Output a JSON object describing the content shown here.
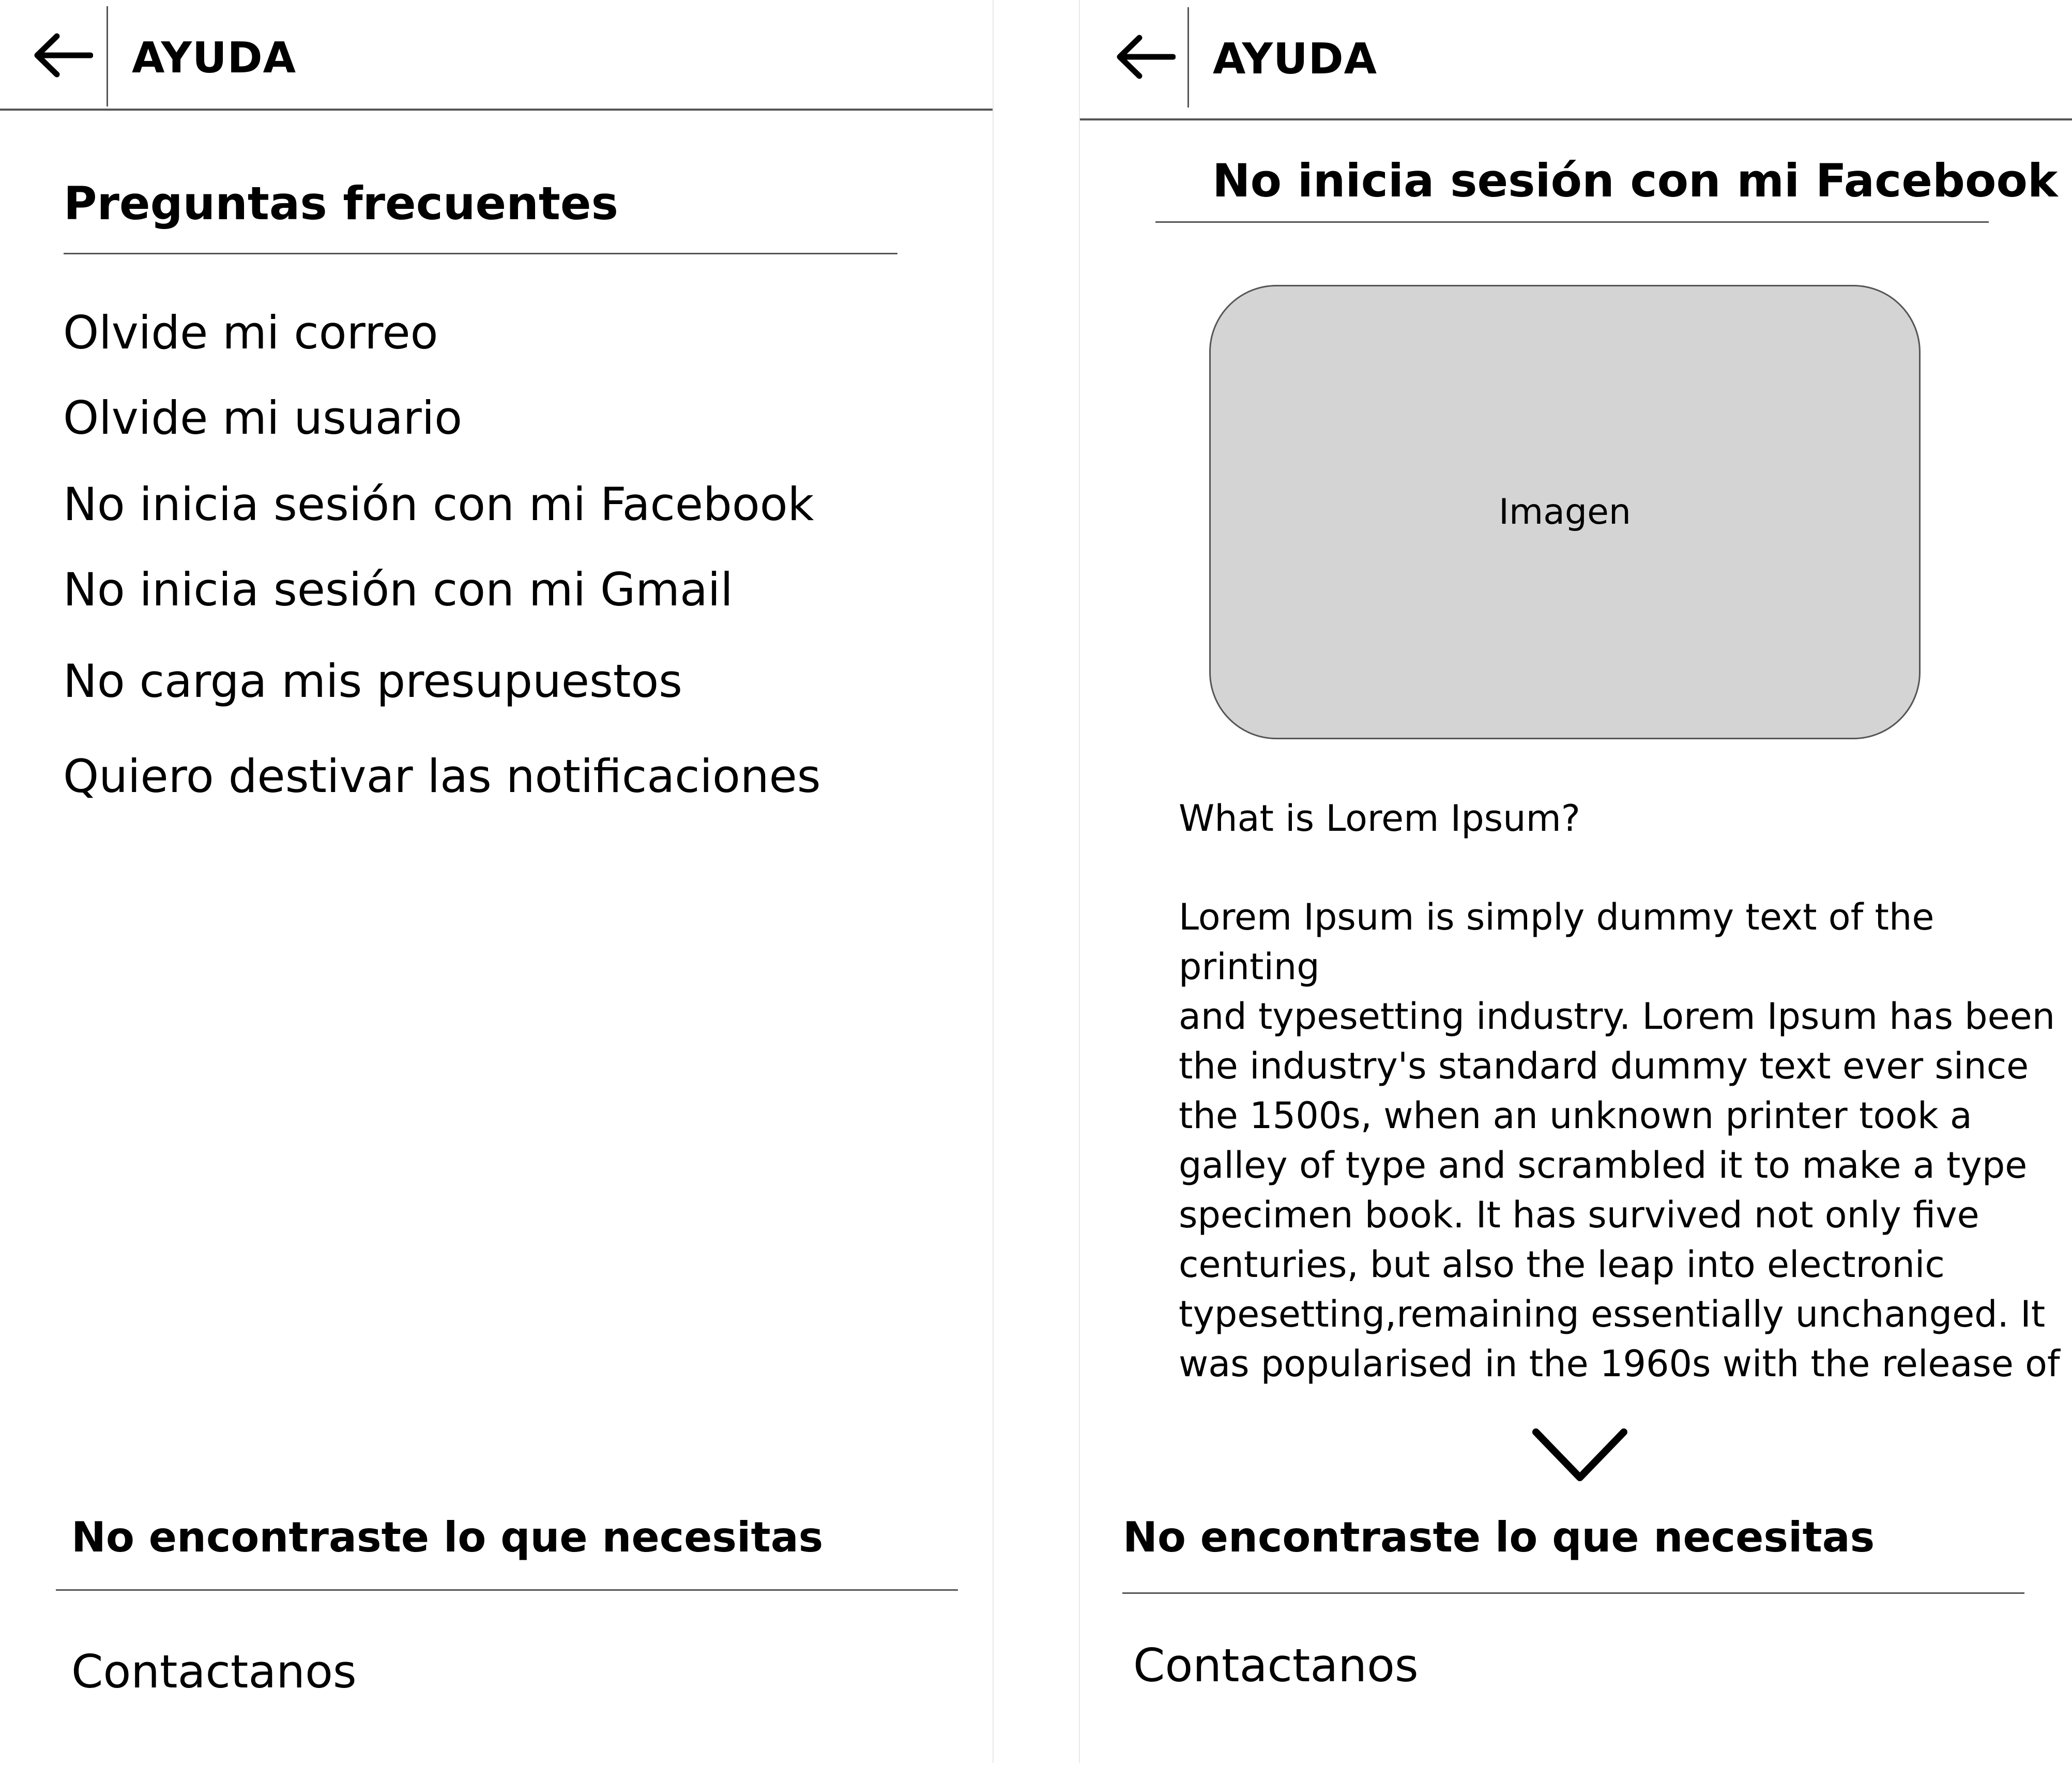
{
  "left_screen": {
    "header": {
      "back_icon": "arrow-left-icon",
      "title": "AYUDA"
    },
    "section_title": "Preguntas frecuentes",
    "faq_items": [
      "Olvide mi correo",
      "Olvide mi usuario",
      "No inicia sesión con mi Facebook",
      "No inicia sesión con mi Gmail",
      "No carga mis presupuestos",
      "Quiero destivar las notificaciones"
    ],
    "footer": {
      "title": "No encontraste lo que necesitas",
      "contact_label": "Contactanos"
    }
  },
  "right_screen": {
    "header": {
      "back_icon": "arrow-left-icon",
      "title": "AYUDA"
    },
    "article_title": "No inicia sesión con mi Facebook",
    "image_placeholder_label": "Imagen",
    "article": {
      "question": "What is Lorem Ipsum?",
      "lines": [
        "Lorem Ipsum is simply dummy text of the",
        "printing",
        "and typesetting industry. Lorem Ipsum has been",
        "the industry's standard dummy text ever since",
        "the 1500s, when an unknown printer took a",
        "galley of type and scrambled it to make a type",
        "specimen book. It has survived not only five",
        "centuries, but also the leap into electronic",
        "typesetting,remaining essentially unchanged. It",
        "was popularised in the 1960s with the release of"
      ]
    },
    "expand_icon": "chevron-down-icon",
    "footer": {
      "title": "No encontraste lo que necesitas",
      "contact_label": "Contactanos"
    }
  },
  "colors": {
    "background": "#ffffff",
    "text": "#000000",
    "divider": "#555555",
    "image_placeholder_fill": "#d4d4d4"
  }
}
